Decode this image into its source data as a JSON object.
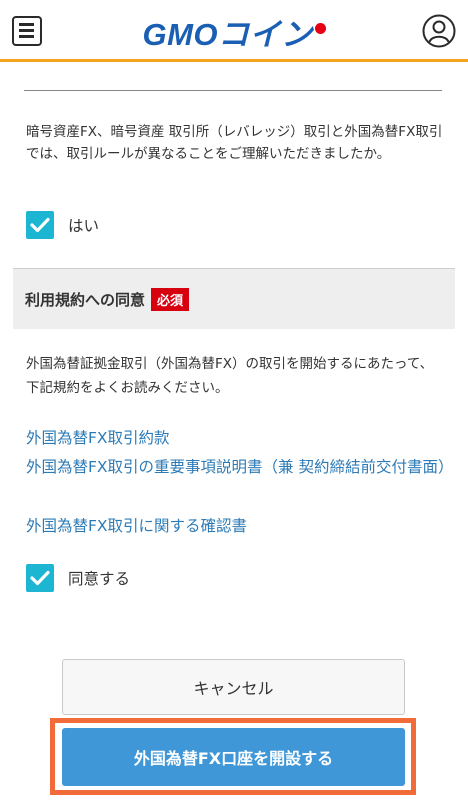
{
  "header": {
    "logo_text": "GMOコイン",
    "menu_icon": "hamburger-menu-icon",
    "user_icon": "user-account-icon",
    "accent_color": "#f5a31a"
  },
  "question": {
    "text": "暗号資産FX、暗号資産 取引所（レバレッジ）取引と外国為替FX取引では、取引ルールが異なることをご理解いただきましたか。",
    "checkbox_label": "はい",
    "checked": true
  },
  "terms": {
    "title": "利用規約への同意",
    "required_badge": "必須",
    "intro": "外国為替証拠金取引（外国為替FX）の取引を開始するにあたって、下記規約をよくお読みください。",
    "links": [
      "外国為替FX取引約款",
      "外国為替FX取引の重要事項説明書（兼 契約締結前交付書面）",
      "外国為替FX取引に関する確認書"
    ],
    "agree_label": "同意する",
    "agree_checked": true
  },
  "buttons": {
    "cancel": "キャンセル",
    "open_account": "外国為替FX口座を開設する"
  },
  "colors": {
    "checkbox": "#1cb6d2",
    "link": "#2d7bb6",
    "primary_button": "#3f97d7",
    "required_badge": "#d7000f",
    "highlight": "#f26b3a"
  }
}
